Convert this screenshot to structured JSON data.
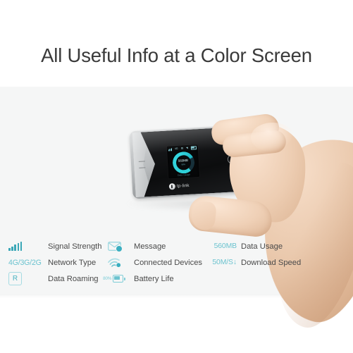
{
  "page": {
    "background_color": "#ffffff",
    "band_color": "#f5f6f6",
    "accent_color": "#4fb6c4",
    "text_color": "#4a4a4a"
  },
  "headline": {
    "text": "All Useful Info at a Color Screen"
  },
  "device": {
    "brand": "tp-link",
    "product_type": "mobile wifi hotspot router",
    "body_colors": {
      "front_panel": "#141517",
      "side_panels": "#c9cbcc"
    },
    "buttons": [
      {
        "name": "menu-button",
        "label": ""
      },
      {
        "name": "power-button",
        "label": ""
      }
    ],
    "screen": {
      "status_icons": [
        "signal-bars",
        "network-type",
        "sim",
        "wifi",
        "battery"
      ],
      "gauge_value": "560MB",
      "gauge_unit": "98%",
      "footer_text": "Data Usage",
      "gauge_color": "#2fd0d8",
      "background_color": "#060708"
    }
  },
  "legend": {
    "rows": [
      {
        "items": [
          {
            "icon": "signal-strength-icon",
            "icon_text": "",
            "label": "Signal Strength"
          },
          {
            "icon": "message-envelope-icon",
            "icon_text": "",
            "label": "Message"
          },
          {
            "icon": "data-usage-value",
            "icon_text": "560MB",
            "label": "Data Usage"
          }
        ]
      },
      {
        "items": [
          {
            "icon": "network-type-icon",
            "icon_text": "4G/3G/2G",
            "label": "Network Type"
          },
          {
            "icon": "connected-devices-wifi-icon",
            "icon_text": "",
            "label": "Connected Devices"
          },
          {
            "icon": "download-speed-value",
            "icon_text": "50M/S",
            "icon_suffix": "↓",
            "label": "Download Speed"
          }
        ]
      },
      {
        "items": [
          {
            "icon": "data-roaming-icon",
            "icon_text": "R",
            "label": "Data Roaming"
          },
          {
            "icon": "battery-life-icon",
            "icon_text": "80%",
            "label": "Battery Life"
          }
        ]
      }
    ]
  }
}
